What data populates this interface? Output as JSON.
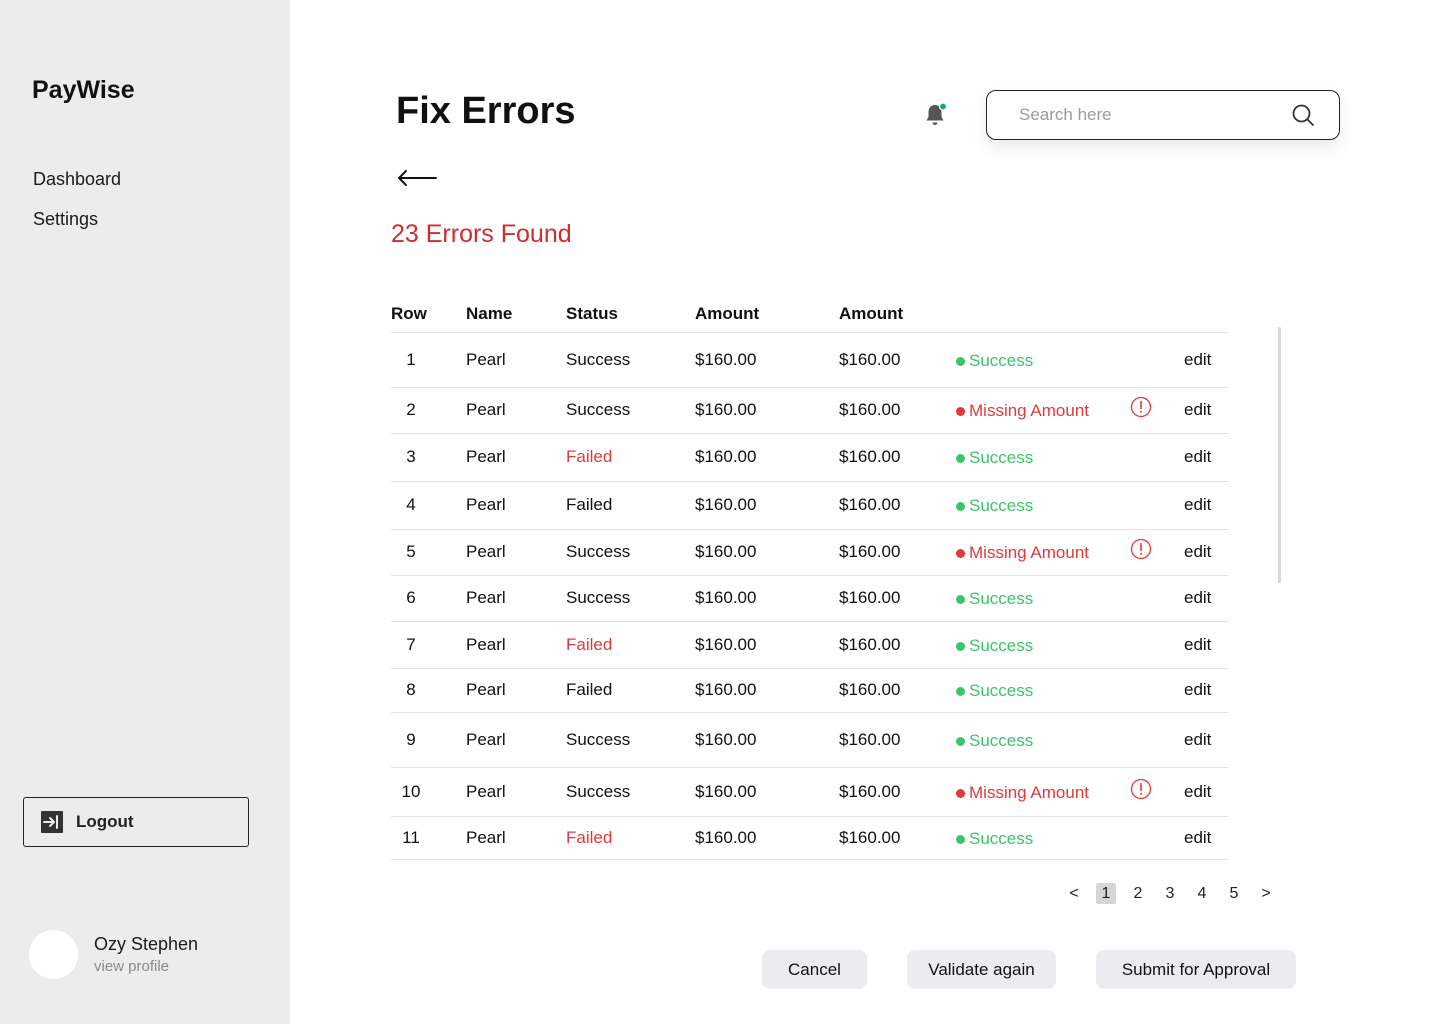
{
  "app": {
    "brand": "PayWise"
  },
  "sidebar": {
    "nav": [
      {
        "label": "Dashboard"
      },
      {
        "label": "Settings"
      }
    ],
    "logout_label": "Logout",
    "profile": {
      "name": "Ozy Stephen",
      "link": "view profile"
    }
  },
  "header": {
    "title": "Fix Errors",
    "search_placeholder": "Search here",
    "notification_dot_color": "#1aa37a"
  },
  "summary": {
    "errors_text": "23 Errors Found"
  },
  "table": {
    "headers": [
      "Row",
      "Name",
      "Status",
      "Amount",
      "Amount"
    ],
    "rows": [
      {
        "row": "1",
        "name": "Pearl",
        "status": "Success",
        "status_failed": false,
        "amount1": "$160.00",
        "amount2": "$160.00",
        "validation": "Success",
        "valid": true,
        "action": "edit"
      },
      {
        "row": "2",
        "name": "Pearl",
        "status": "Success",
        "status_failed": false,
        "amount1": "$160.00",
        "amount2": "$160.00",
        "validation": "Missing Amount",
        "valid": false,
        "action": "edit"
      },
      {
        "row": "3",
        "name": "Pearl",
        "status": "Failed",
        "status_failed": true,
        "amount1": "$160.00",
        "amount2": "$160.00",
        "validation": "Success",
        "valid": true,
        "action": "edit"
      },
      {
        "row": "4",
        "name": "Pearl",
        "status": "Failed",
        "status_failed": false,
        "amount1": "$160.00",
        "amount2": "$160.00",
        "validation": "Success",
        "valid": true,
        "action": "edit"
      },
      {
        "row": "5",
        "name": "Pearl",
        "status": "Success",
        "status_failed": false,
        "amount1": "$160.00",
        "amount2": "$160.00",
        "validation": "Missing Amount",
        "valid": false,
        "action": "edit"
      },
      {
        "row": "6",
        "name": "Pearl",
        "status": "Success",
        "status_failed": false,
        "amount1": "$160.00",
        "amount2": "$160.00",
        "validation": "Success",
        "valid": true,
        "action": "edit"
      },
      {
        "row": "7",
        "name": "Pearl",
        "status": "Failed",
        "status_failed": true,
        "amount1": "$160.00",
        "amount2": "$160.00",
        "validation": "Success",
        "valid": true,
        "action": "edit"
      },
      {
        "row": "8",
        "name": "Pearl",
        "status": "Failed",
        "status_failed": false,
        "amount1": "$160.00",
        "amount2": "$160.00",
        "validation": "Success",
        "valid": true,
        "action": "edit"
      },
      {
        "row": "9",
        "name": "Pearl",
        "status": "Success",
        "status_failed": false,
        "amount1": "$160.00",
        "amount2": "$160.00",
        "validation": "Success",
        "valid": true,
        "action": "edit"
      },
      {
        "row": "10",
        "name": "Pearl",
        "status": "Success",
        "status_failed": false,
        "amount1": "$160.00",
        "amount2": "$160.00",
        "validation": "Missing Amount",
        "valid": false,
        "action": "edit"
      },
      {
        "row": "11",
        "name": "Pearl",
        "status": "Failed",
        "status_failed": true,
        "amount1": "$160.00",
        "amount2": "$160.00",
        "validation": "Success",
        "valid": true,
        "action": "edit"
      }
    ]
  },
  "pagination": {
    "prev": "<",
    "pages": [
      "1",
      "2",
      "3",
      "4",
      "5"
    ],
    "current": "1",
    "next": ">"
  },
  "actions": {
    "cancel": "Cancel",
    "validate": "Validate again",
    "submit": "Submit for Approval"
  },
  "colors": {
    "error_red": "#e03a3a",
    "success_green": "#3cc36b",
    "failed_status_red": "#e03a3a"
  }
}
